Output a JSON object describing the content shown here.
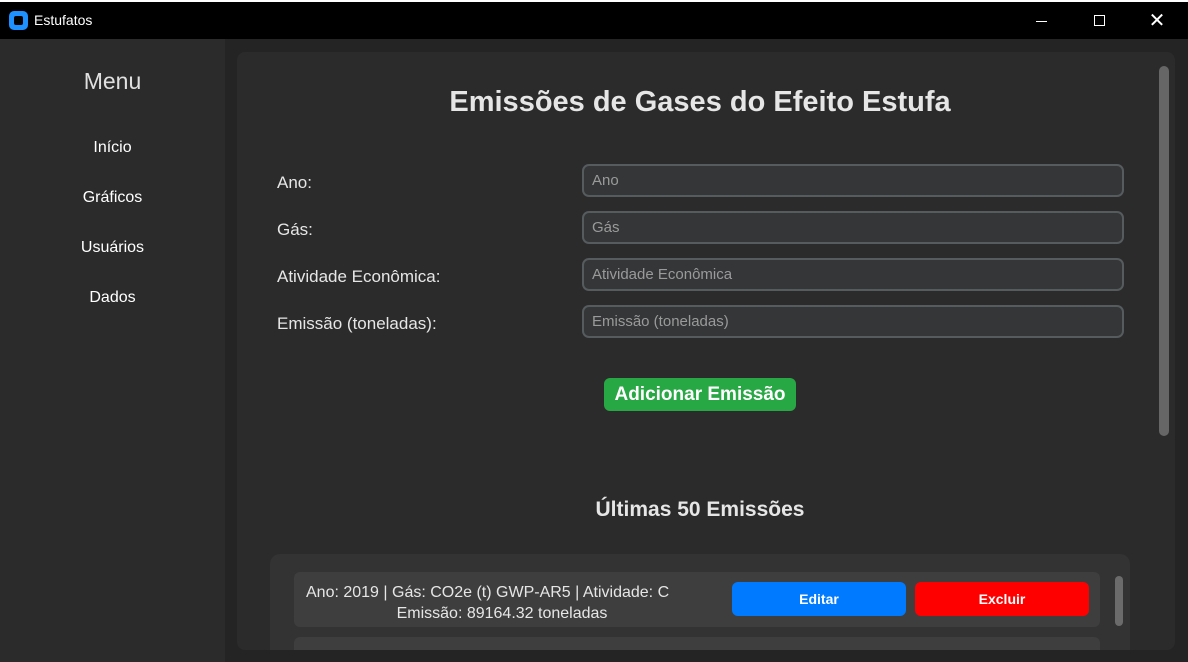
{
  "window": {
    "title": "Estufatos",
    "minimize_glyph": "",
    "close_glyph": "✕"
  },
  "sidebar": {
    "title": "Menu",
    "items": [
      {
        "label": "Início"
      },
      {
        "label": "Gráficos"
      },
      {
        "label": "Usuários"
      },
      {
        "label": "Dados"
      }
    ]
  },
  "main": {
    "title": "Emissões de Gases do Efeito Estufa",
    "form": {
      "fields": [
        {
          "label": "Ano:",
          "placeholder": "Ano",
          "value": ""
        },
        {
          "label": "Gás:",
          "placeholder": "Gás",
          "value": ""
        },
        {
          "label": "Atividade Econômica:",
          "placeholder": "Atividade Econômica",
          "value": ""
        },
        {
          "label": "Emissão (toneladas):",
          "placeholder": "Emissão (toneladas)",
          "value": ""
        }
      ],
      "submit_label": "Adicionar Emissão"
    },
    "list": {
      "title": "Últimas 50 Emissões",
      "items": [
        {
          "line1": "Ano: 2019 | Gás: CO2e (t) GWP-AR5 | Atividade: C",
          "line2": "Emissão: 89164.32 toneladas",
          "edit_label": "Editar",
          "delete_label": "Excluir"
        }
      ]
    }
  },
  "colors": {
    "accent_green": "#28a745",
    "edit_blue": "#007bff",
    "delete_red": "#ff0000",
    "app_icon_blue": "#1e90ff"
  },
  "icons": [
    "app-icon",
    "minimize-icon",
    "maximize-icon",
    "close-icon"
  ]
}
